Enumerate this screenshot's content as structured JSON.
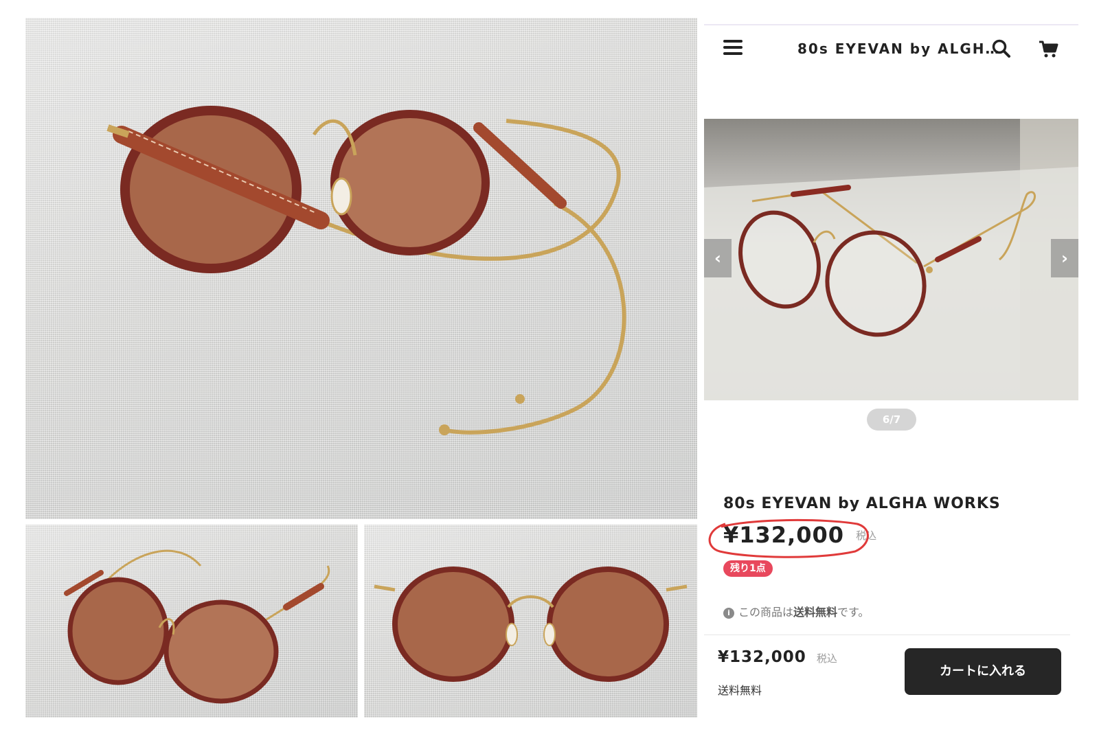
{
  "header": {
    "title": "80s EYEVAN by ALGH…",
    "menu_icon": "hamburger-menu-icon",
    "search_icon": "search-icon",
    "cart_icon": "cart-icon"
  },
  "gallery": {
    "counter": "6/7",
    "prev_glyph": "‹",
    "next_glyph": "›"
  },
  "product": {
    "title": "80s EYEVAN by ALGHA WORKS",
    "price": "¥132,000",
    "tax_label": "税込",
    "stock_badge": "残り1点",
    "shipping_note_prefix": "この商品は",
    "shipping_note_strong": "送料無料",
    "shipping_note_suffix": "です。",
    "info_glyph": "i"
  },
  "purchase_bar": {
    "price": "¥132,000",
    "tax_label": "税込",
    "shipping": "送料無料",
    "cart_button_label": "カートに入れる"
  },
  "colors": {
    "accent_badge": "#e8485d",
    "button_dark": "#262626",
    "annotation_circle": "#e03a3a",
    "frame_rim": "#7a2a22",
    "lens": "#a8674a",
    "gold": "#c9a45a"
  }
}
